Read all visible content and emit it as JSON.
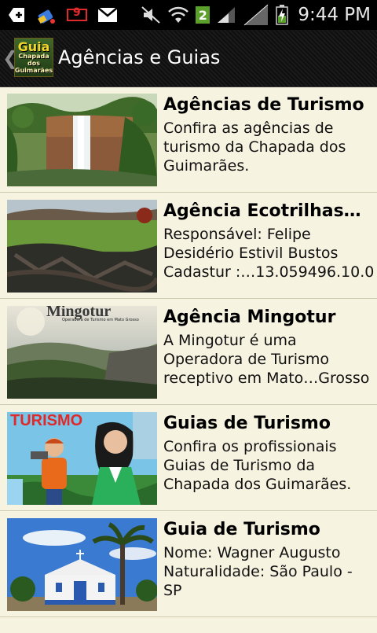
{
  "status_bar": {
    "time": "9:44 PM",
    "notification_icons": [
      "add-icon",
      "eraser-icon",
      "voicemail-icon",
      "gmail-icon"
    ],
    "notification_badge": "9",
    "sim_badge": "2",
    "system_icons": [
      "mute-icon",
      "wifi-icon",
      "sim2-icon",
      "signal-icon",
      "signal-weak-icon",
      "battery-charging-icon"
    ]
  },
  "action_bar": {
    "title": "Agências e Guias",
    "logo_text_1": "Guia",
    "logo_text_2": "Chapada dos Guimarães",
    "back_icon": "chevron-left-icon"
  },
  "items": [
    {
      "title": "Agências de Turismo",
      "desc": [
        "Confira as agências de",
        "turismo da Chapada dos",
        "Guimarães."
      ],
      "image": "waterfall"
    },
    {
      "title": "Agência Ecotrilhas…",
      "desc": [
        "Responsável: Felipe",
        "Desidério Estivil Bustos",
        "Cadastur :…13.059496.10.0"
      ],
      "image": "burnt-field"
    },
    {
      "title": "Agência Mingotur",
      "desc": [
        "A Mingotur é uma",
        "Operadora de Turismo",
        "receptivo em Mato…Grosso"
      ],
      "image": "valley",
      "image_caption": "Mingotur",
      "image_subcaption": "Operadora de Turismo em Mato Grosso"
    },
    {
      "title": "Guias de Turismo",
      "desc": [
        "Confira os profissionais",
        "Guias de Turismo da",
        "Chapada dos Guimarães."
      ],
      "image": "cartoon-guides",
      "image_caption": "TURISMO"
    },
    {
      "title": "Guia de Turismo",
      "desc": [
        "Nome: Wagner Augusto",
        "Naturalidade: São Paulo -",
        "SP"
      ],
      "image": "church"
    }
  ],
  "colors": {
    "list_bg": "#f7f3e1",
    "actionbar_bg": "#141414",
    "divider": "#cfc9b2"
  }
}
